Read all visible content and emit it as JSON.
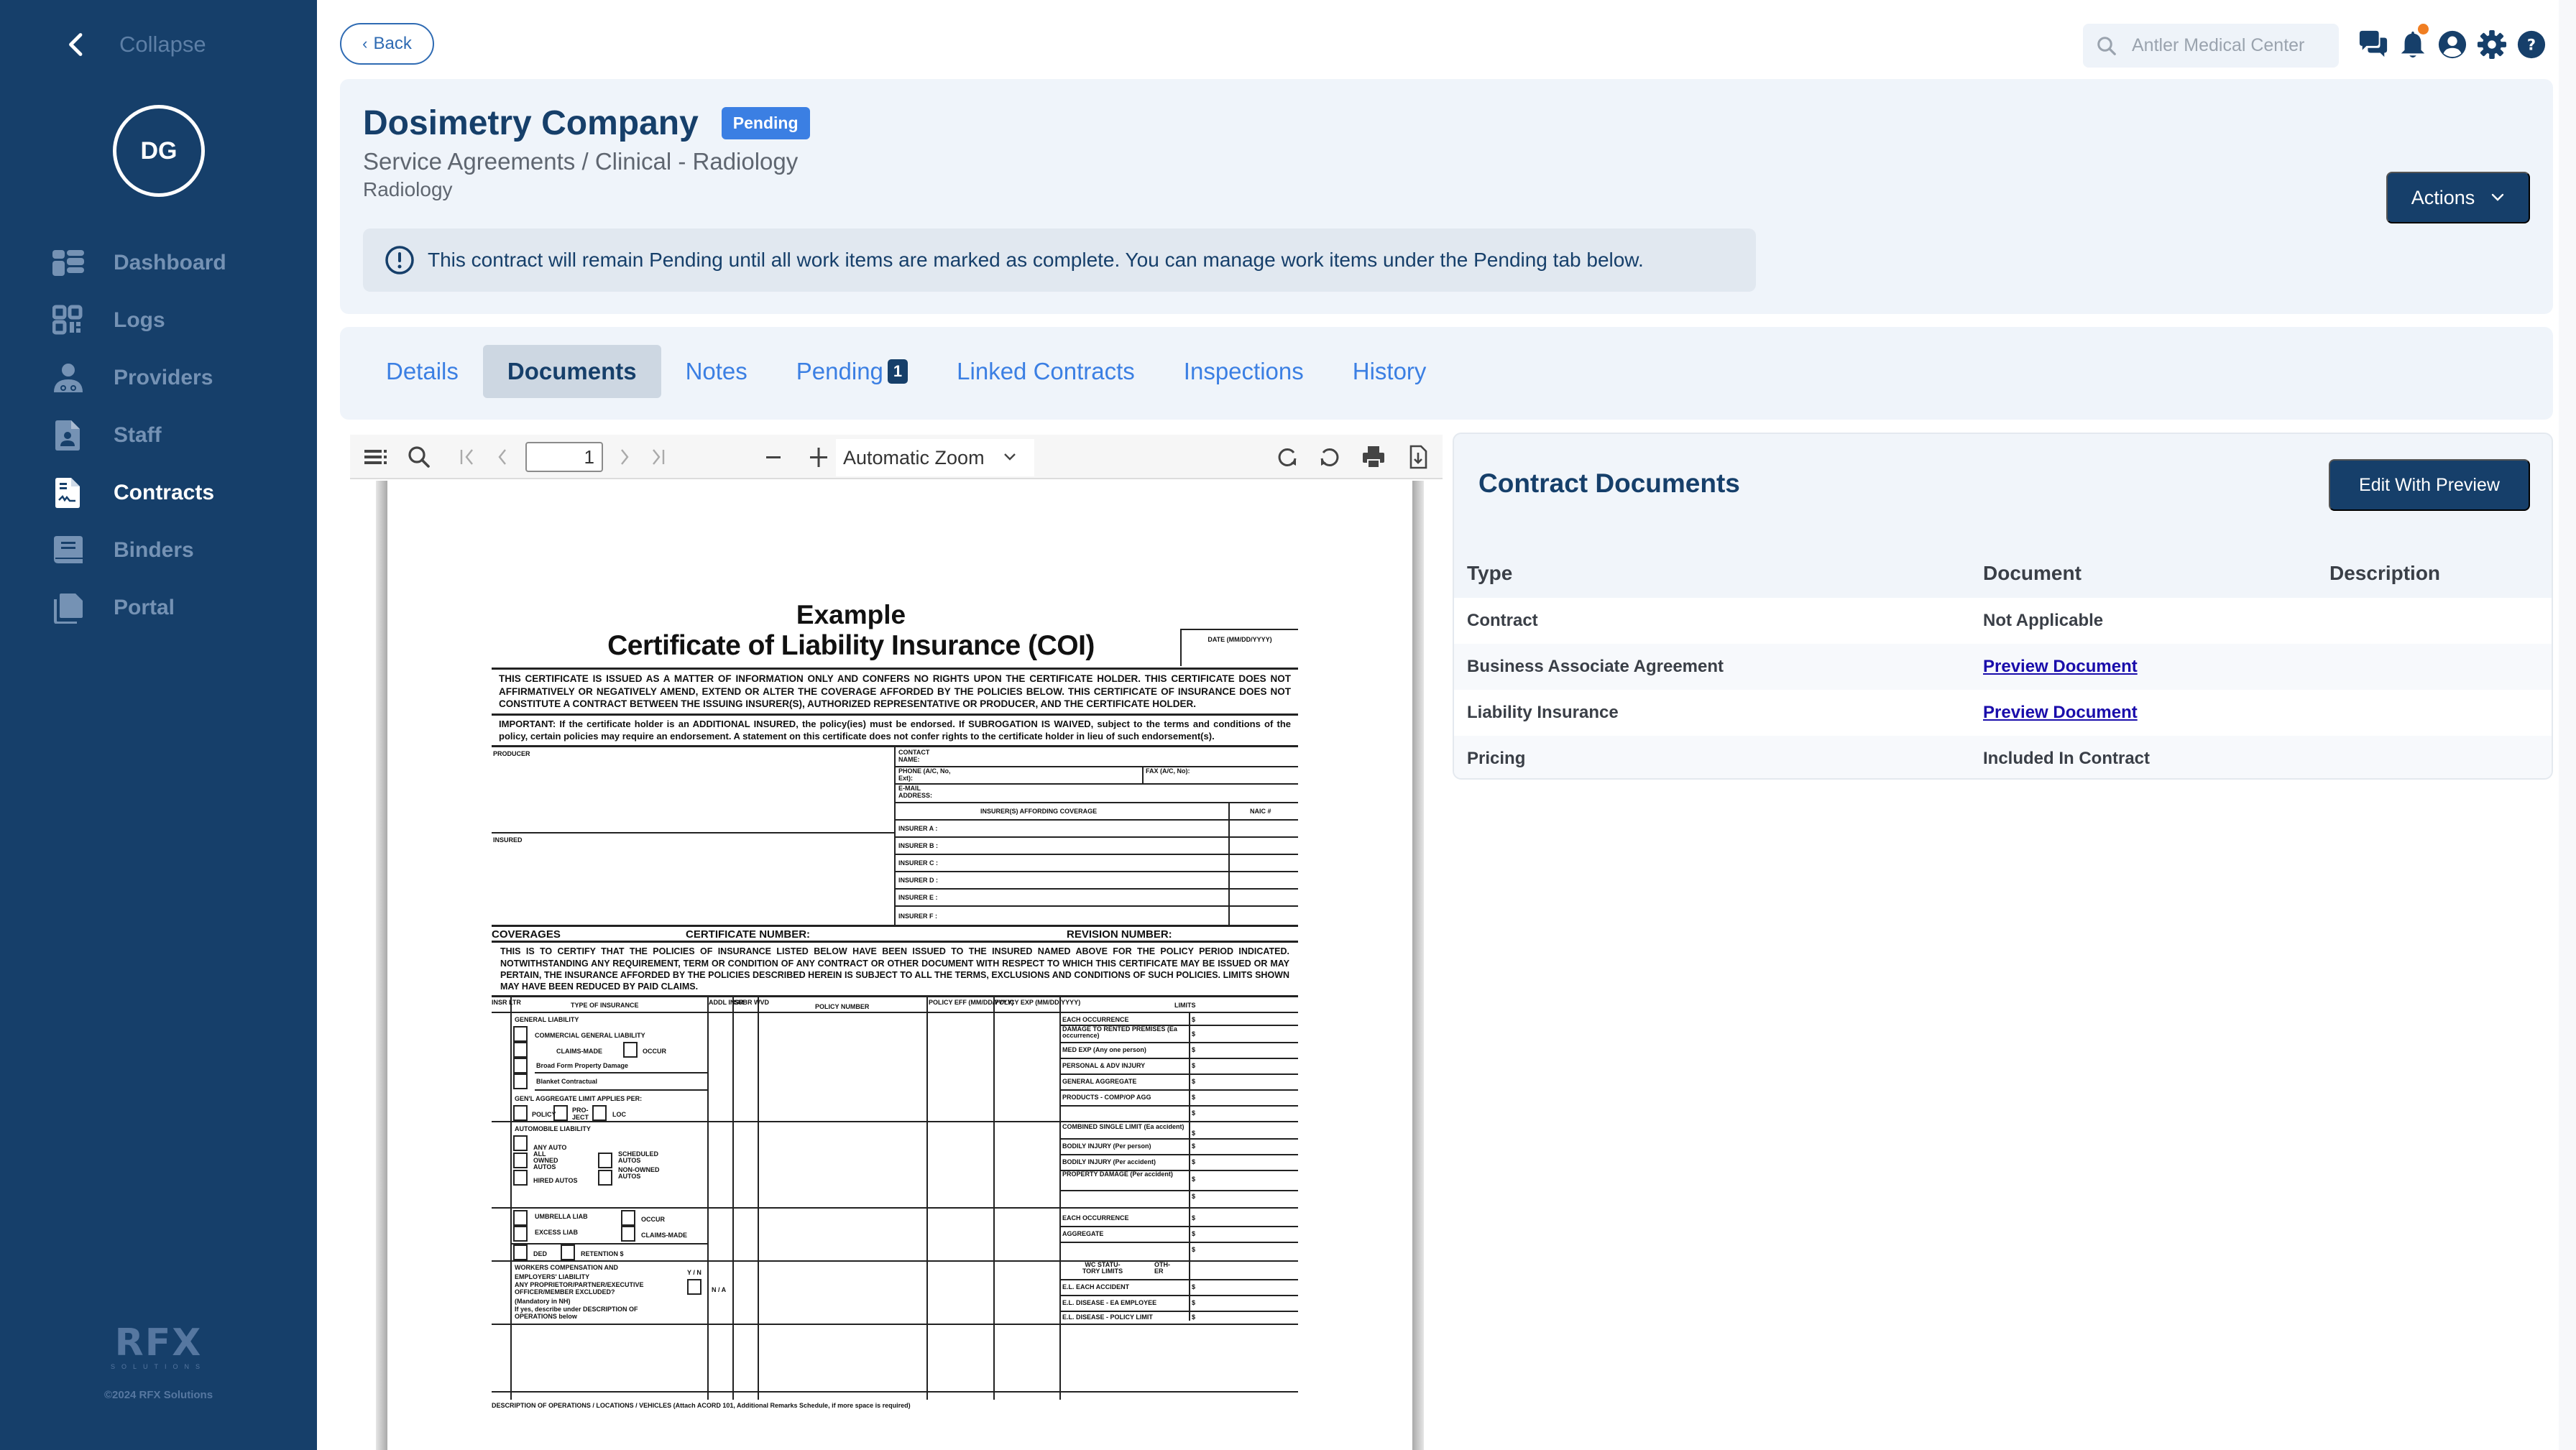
{
  "sidebar": {
    "collapse_label": "Collapse",
    "avatar_initials": "DG",
    "items": [
      {
        "label": "Dashboard",
        "icon": "dashboard-icon",
        "active": false
      },
      {
        "label": "Logs",
        "icon": "qr-code-icon",
        "active": false
      },
      {
        "label": "Providers",
        "icon": "doctor-icon",
        "active": false
      },
      {
        "label": "Staff",
        "icon": "staff-file-icon",
        "active": false
      },
      {
        "label": "Contracts",
        "icon": "contract-file-icon",
        "active": true
      },
      {
        "label": "Binders",
        "icon": "binder-icon",
        "active": false
      },
      {
        "label": "Portal",
        "icon": "copy-files-icon",
        "active": false
      }
    ],
    "brand_name": "RFX",
    "brand_sub": "SOLUTIONS",
    "copyright": "©2024 RFX Solutions"
  },
  "topbar": {
    "back_label": "Back",
    "search_placeholder": "Antler Medical Center",
    "icons": [
      "chat-icon",
      "bell-icon",
      "user-circle-icon",
      "gear-icon",
      "help-icon"
    ],
    "has_notification": true
  },
  "header": {
    "title": "Dosimetry Company",
    "status": "Pending",
    "breadcrumb": "Service Agreements / Clinical - Radiology",
    "subcategory": "Radiology",
    "actions_label": "Actions",
    "notice": "This contract will remain Pending until all work items are marked as complete. You can manage work items under the Pending tab below."
  },
  "tabs": [
    {
      "label": "Details",
      "active": false
    },
    {
      "label": "Documents",
      "active": true
    },
    {
      "label": "Notes",
      "active": false
    },
    {
      "label": "Pending",
      "active": false,
      "count": "1"
    },
    {
      "label": "Linked Contracts",
      "active": false
    },
    {
      "label": "Inspections",
      "active": false
    },
    {
      "label": "History",
      "active": false
    }
  ],
  "pdf_viewer": {
    "page_number": "1",
    "zoom_label": "Automatic Zoom",
    "document": {
      "heading": "Example",
      "title": "Certificate of Liability Insurance (COI)",
      "date_label": "DATE (MM/DD/YYYY)",
      "disclaimer": "THIS CERTIFICATE IS ISSUED AS A MATTER OF INFORMATION ONLY AND CONFERS NO RIGHTS UPON THE CERTIFICATE HOLDER. THIS CERTIFICATE DOES NOT AFFIRMATIVELY OR NEGATIVELY AMEND, EXTEND OR ALTER THE COVERAGE AFFORDED BY THE POLICIES BELOW. THIS CERTIFICATE OF INSURANCE DOES NOT CONSTITUTE A CONTRACT BETWEEN THE ISSUING INSURER(S), AUTHORIZED REPRESENTATIVE OR PRODUCER, AND THE CERTIFICATE HOLDER.",
      "important": "IMPORTANT: If the certificate holder is an ADDITIONAL INSURED, the policy(ies) must be endorsed. If SUBROGATION IS WAIVED, subject to the terms and conditions of the policy, certain policies may require an endorsement. A statement on this certificate does not confer rights to the certificate holder in lieu of such endorsement(s).",
      "producer_label": "PRODUCER",
      "insured_label": "INSURED",
      "contact_name": "CONTACT NAME:",
      "phone": "PHONE (A/C, No, Ext):",
      "fax": "FAX (A/C, No):",
      "email": "E-MAIL ADDRESS:",
      "insurers_header": "INSURER(S) AFFORDING COVERAGE",
      "naic": "NAIC #",
      "insurers": [
        "INSURER A :",
        "INSURER B :",
        "INSURER C :",
        "INSURER D :",
        "INSURER E :",
        "INSURER F :"
      ],
      "coverages": "COVERAGES",
      "certificate_number": "CERTIFICATE NUMBER:",
      "revision_number": "REVISION NUMBER:",
      "certify_text": "THIS IS TO CERTIFY THAT THE POLICIES OF INSURANCE LISTED BELOW HAVE BEEN ISSUED TO THE INSURED NAMED ABOVE FOR THE POLICY PERIOD INDICATED. NOTWITHSTANDING ANY REQUIREMENT, TERM OR CONDITION OF ANY CONTRACT OR OTHER DOCUMENT WITH RESPECT TO WHICH THIS CERTIFICATE MAY BE ISSUED OR MAY PERTAIN, THE INSURANCE AFFORDED BY THE POLICIES DESCRIBED HEREIN IS SUBJECT TO ALL THE TERMS, EXCLUSIONS AND CONDITIONS OF SUCH POLICIES. LIMITS SHOWN MAY HAVE BEEN REDUCED BY PAID CLAIMS.",
      "table_headers": {
        "insr_ltr": "INSR LTR",
        "type": "TYPE OF INSURANCE",
        "addl": "ADDL INSR",
        "subr": "SUBR WVD",
        "policy_number": "POLICY NUMBER",
        "eff": "POLICY EFF (MM/DD/YYYY)",
        "exp": "POLICY EXP (MM/DD/YYYY)",
        "limits": "LIMITS"
      },
      "general_liability": {
        "label": "GENERAL LIABILITY",
        "items": [
          "COMMERCIAL GENERAL LIABILITY",
          "CLAIMS-MADE",
          "OCCUR",
          "Broad Form Property Damage",
          "Blanket Contractual",
          "GEN'L AGGREGATE LIMIT APPLIES PER:",
          "POLICY",
          "PRO-JECT",
          "LOC"
        ],
        "limits": [
          "EACH OCCURRENCE",
          "DAMAGE TO RENTED PREMISES (Ea occurrence)",
          "MED EXP (Any one person)",
          "PERSONAL & ADV INJURY",
          "GENERAL AGGREGATE",
          "PRODUCTS - COMP/OP AGG",
          ""
        ]
      },
      "auto_liability": {
        "label": "AUTOMOBILE LIABILITY",
        "items": [
          "ANY AUTO",
          "ALL OWNED AUTOS",
          "SCHEDULED AUTOS",
          "HIRED AUTOS",
          "NON-OWNED AUTOS"
        ],
        "limits": [
          "COMBINED SINGLE LIMIT (Ea accident)",
          "BODILY INJURY (Per person)",
          "BODILY INJURY (Per accident)",
          "PROPERTY DAMAGE (Per accident)",
          ""
        ]
      },
      "umbrella": {
        "items": [
          "UMBRELLA LIAB",
          "OCCUR",
          "EXCESS LIAB",
          "CLAIMS-MADE",
          "DED",
          "RETENTION $"
        ],
        "limits": [
          "EACH OCCURRENCE",
          "AGGREGATE",
          ""
        ]
      },
      "workers_comp": {
        "label": "WORKERS COMPENSATION AND EMPLOYERS' LIABILITY",
        "yn": "Y / N",
        "question": "ANY PROPRIETOR/PARTNER/EXECUTIVE OFFICER/MEMBER EXCLUDED?",
        "mandatory": "(Mandatory in NH)",
        "describe": "If yes, describe under DESCRIPTION OF OPERATIONS below",
        "na": "N / A",
        "statutory": "WC STATU-TORY LIMITS",
        "other": "OTH-ER",
        "limits": [
          "E.L. EACH ACCIDENT",
          "E.L. DISEASE - EA EMPLOYEE",
          "E.L. DISEASE - POLICY LIMIT"
        ]
      },
      "currency": "$",
      "description_footer": "DESCRIPTION OF OPERATIONS / LOCATIONS / VEHICLES (Attach ACORD 101, Additional Remarks Schedule, if more space is required)"
    }
  },
  "contract_documents": {
    "title": "Contract Documents",
    "edit_label": "Edit With Preview",
    "columns": [
      "Type",
      "Document",
      "Description"
    ],
    "rows": [
      {
        "type": "Contract",
        "document": "Not Applicable",
        "is_link": false,
        "description": ""
      },
      {
        "type": "Business Associate Agreement",
        "document": "Preview Document",
        "is_link": true,
        "description": ""
      },
      {
        "type": "Liability Insurance",
        "document": "Preview Document",
        "is_link": true,
        "description": ""
      },
      {
        "type": "Pricing",
        "document": "Included In Contract",
        "is_link": false,
        "description": ""
      }
    ]
  },
  "colors": {
    "sidebar_bg": "#163f6a",
    "primary": "#163f6a",
    "accent": "#3b7fe3",
    "notification": "#f07e22",
    "link": "#1a0dab"
  }
}
